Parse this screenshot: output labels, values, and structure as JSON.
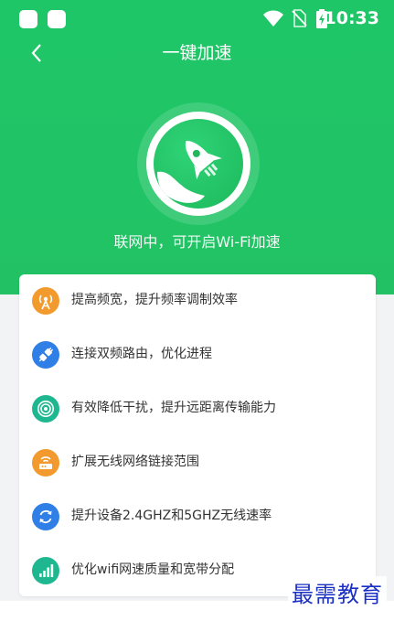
{
  "status_bar": {
    "time": "10:33"
  },
  "header": {
    "title": "一键加速"
  },
  "hero": {
    "status_text": "联网中，可开启Wi-Fi加速"
  },
  "features": [
    {
      "label": "提高频宽，提升频率调制效率",
      "icon": "antenna-icon",
      "color": "#f39a2e"
    },
    {
      "label": "连接双频路由，优化进程",
      "icon": "plug-icon",
      "color": "#2f7fe6"
    },
    {
      "label": "有效降低干扰，提升远距离传输能力",
      "icon": "signal-icon",
      "color": "#1fb78f"
    },
    {
      "label": "扩展无线网络链接范围",
      "icon": "router-icon",
      "color": "#f39a2e"
    },
    {
      "label": "提升设备2.4GHZ和5GHZ无线速率",
      "icon": "refresh-icon",
      "color": "#2f7fe6"
    },
    {
      "label": "优化wifi网速质量和宽带分配",
      "icon": "bars-icon",
      "color": "#1fb78f"
    }
  ],
  "watermark": "最需教育",
  "colors": {
    "brand_green": "#20c466",
    "text_dark": "#333333",
    "card_bg": "#ffffff"
  }
}
